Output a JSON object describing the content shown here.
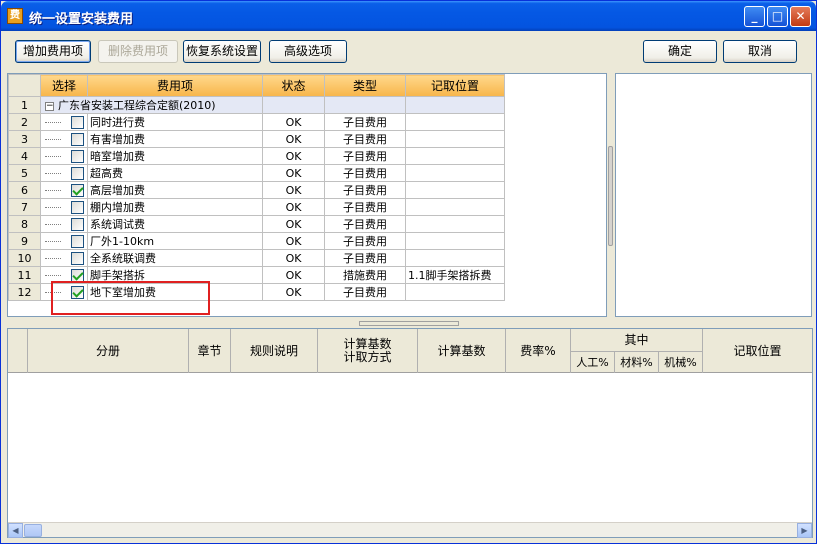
{
  "window": {
    "title": "统一设置安装费用",
    "app_icon": "app-icon"
  },
  "titlebar_buttons": {
    "minimize": "_",
    "maximize": "□",
    "close": "✕"
  },
  "toolbar": {
    "add_label": "增加费用项",
    "delete_label": "删除费用项",
    "restore_label": "恢复系统设置",
    "advanced_label": "高级选项",
    "ok_label": "确定",
    "cancel_label": "取消"
  },
  "grid": {
    "columns": [
      "选择",
      "费用项",
      "状态",
      "类型",
      "记取位置"
    ],
    "group": {
      "row": "1",
      "expander": "−",
      "name": "广东省安装工程综合定额(2010)"
    },
    "rows": [
      {
        "row": "2",
        "checked": false,
        "name": "同时进行费",
        "status": "OK",
        "type": "子目费用",
        "position": ""
      },
      {
        "row": "3",
        "checked": false,
        "name": "有害增加费",
        "status": "OK",
        "type": "子目费用",
        "position": ""
      },
      {
        "row": "4",
        "checked": false,
        "name": "暗室增加费",
        "status": "OK",
        "type": "子目费用",
        "position": ""
      },
      {
        "row": "5",
        "checked": false,
        "name": "超高费",
        "status": "OK",
        "type": "子目费用",
        "position": ""
      },
      {
        "row": "6",
        "checked": true,
        "name": "高层增加费",
        "status": "OK",
        "type": "子目费用",
        "position": ""
      },
      {
        "row": "7",
        "checked": false,
        "name": "棚内增加费",
        "status": "OK",
        "type": "子目费用",
        "position": ""
      },
      {
        "row": "8",
        "checked": false,
        "name": "系统调试费",
        "status": "OK",
        "type": "子目费用",
        "position": ""
      },
      {
        "row": "9",
        "checked": false,
        "name": "厂外1-10km",
        "status": "OK",
        "type": "子目费用",
        "position": ""
      },
      {
        "row": "10",
        "checked": false,
        "name": "全系统联调费",
        "status": "OK",
        "type": "子目费用",
        "position": ""
      },
      {
        "row": "11",
        "checked": true,
        "name": "脚手架搭拆",
        "status": "OK",
        "type": "措施费用",
        "position": "1.1脚手架搭拆费"
      },
      {
        "row": "12",
        "checked": true,
        "name": "地下室增加费",
        "status": "OK",
        "type": "子目费用",
        "position": ""
      }
    ]
  },
  "bottom_grid": {
    "columns": {
      "fence": "分册",
      "chapter": "章节",
      "rule": "规则说明",
      "calc_base_method": "计算基数\n计取方式",
      "calc_base": "计算基数",
      "rate": "费率%",
      "of_which": "其中",
      "labor": "人工%",
      "material": "材料%",
      "machine": "机械%",
      "position": "记取位置"
    }
  },
  "scroll": {
    "left_arrow": "◀",
    "right_arrow": "▶"
  },
  "colors": {
    "title_bar": "#0558e4",
    "grid_header": "#f7b54a",
    "highlight_box": "#e02020"
  }
}
